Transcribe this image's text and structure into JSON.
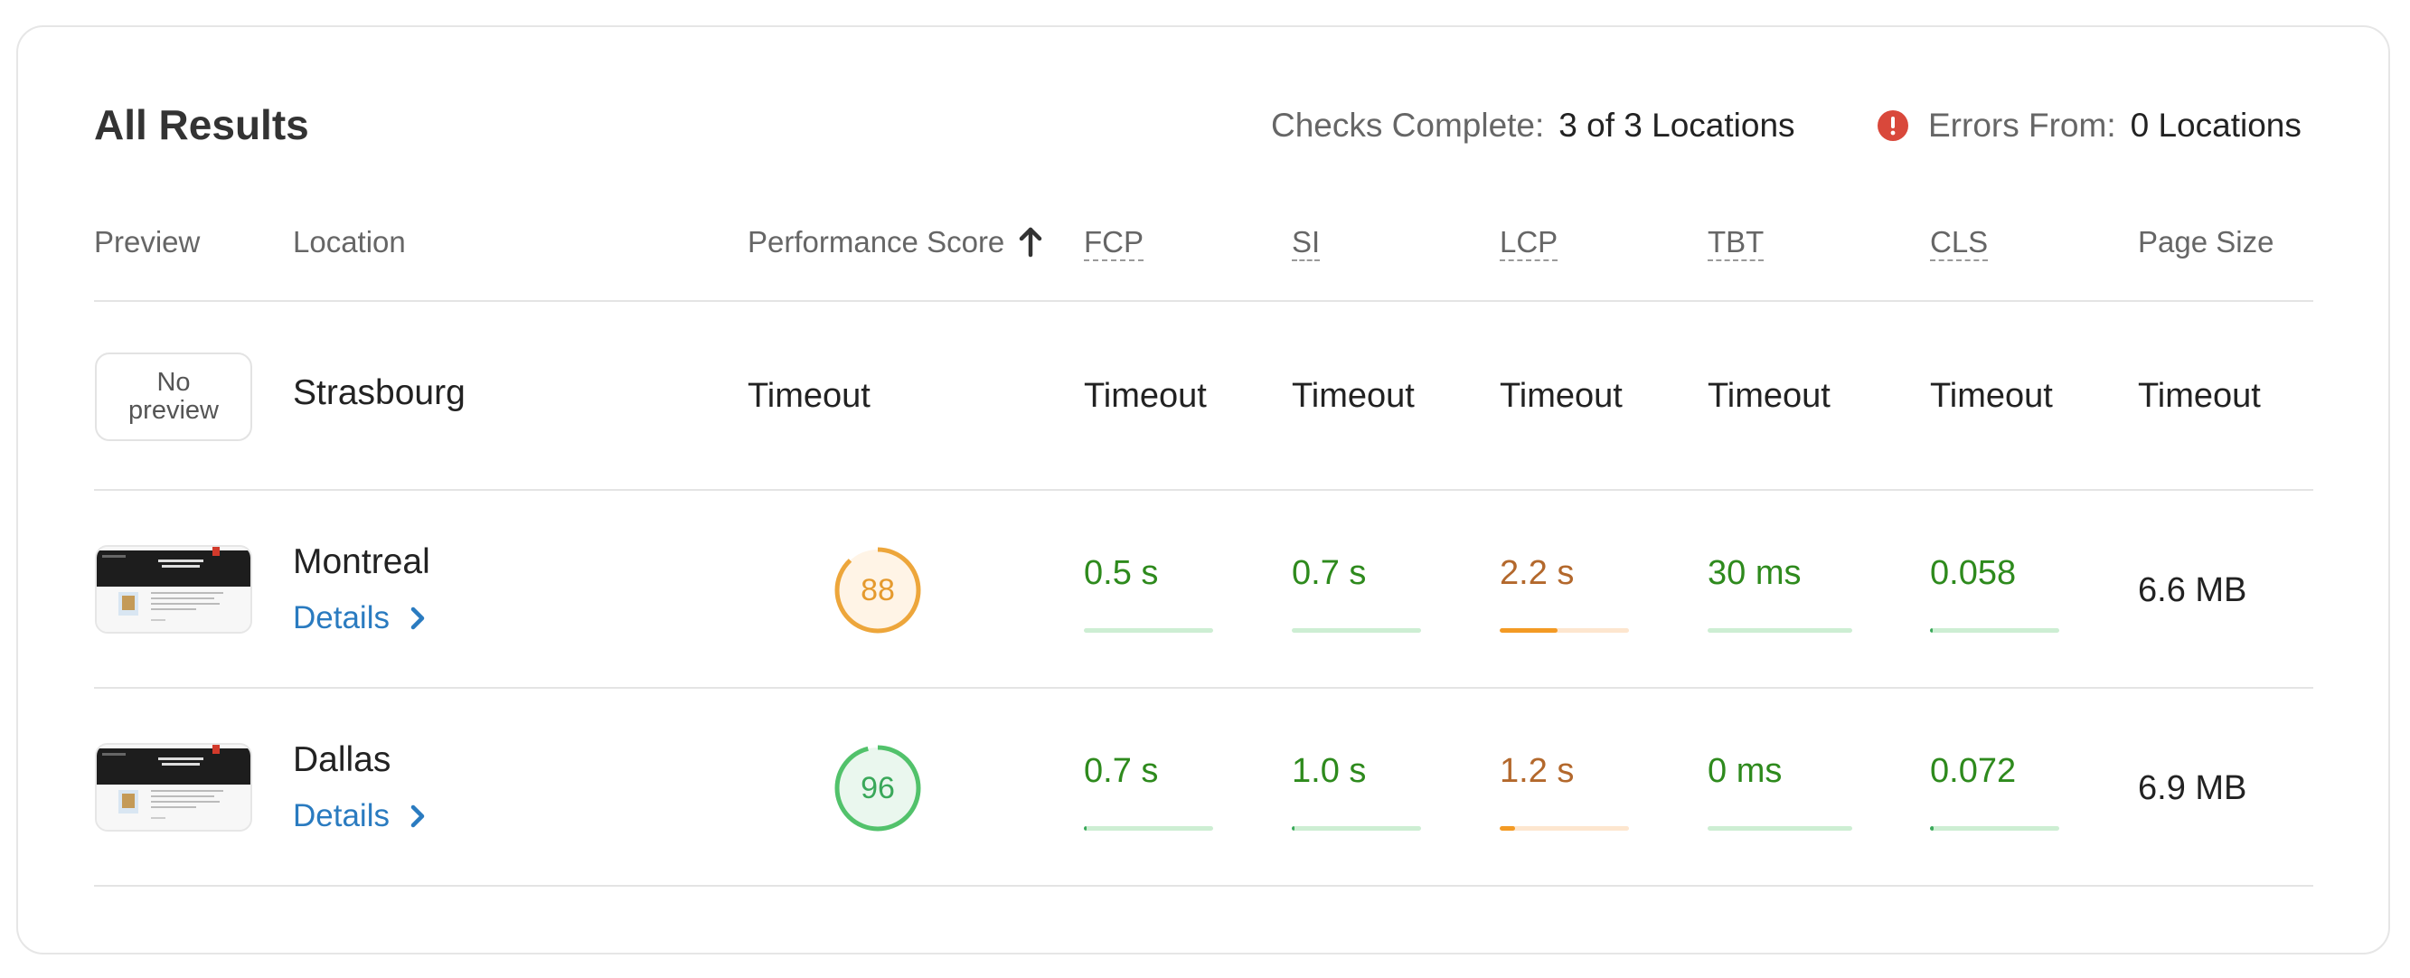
{
  "title": "All Results",
  "summary": {
    "checks_label": "Checks Complete:",
    "checks_value": "3 of 3 Locations",
    "errors_label": "Errors From:",
    "errors_value": "0 Locations"
  },
  "columns": {
    "preview": "Preview",
    "location": "Location",
    "performance": "Performance Score",
    "fcp": "FCP",
    "si": "SI",
    "lcp": "LCP",
    "tbt": "TBT",
    "cls": "CLS",
    "page_size": "Page Size"
  },
  "colors": {
    "good": "#2e8a1d",
    "average": "#b3682c",
    "score_avg_ring": "#eda63b",
    "score_avg_text": "#e59a2e",
    "score_good_ring": "#52c26b",
    "score_good_text": "#3aa85a",
    "link": "#2a7bc0",
    "error": "#d9483b"
  },
  "rows": [
    {
      "preview": "No\npreview",
      "location": "Strasbourg",
      "performance": "Timeout",
      "fcp": "Timeout",
      "si": "Timeout",
      "lcp": "Timeout",
      "tbt": "Timeout",
      "cls": "Timeout",
      "page_size": "Timeout"
    },
    {
      "location": "Montreal",
      "details": "Details",
      "score": "88",
      "score_fraction": 0.88,
      "fcp": "0.5 s",
      "si": "0.7 s",
      "lcp": "2.2 s",
      "tbt": "30 ms",
      "cls": "0.058",
      "page_size": "6.6 MB",
      "bars": {
        "fcp": 0.0,
        "si": 0.0,
        "lcp": 0.45,
        "tbt": 0.0,
        "cls": 0.02
      }
    },
    {
      "location": "Dallas",
      "details": "Details",
      "score": "96",
      "score_fraction": 0.96,
      "fcp": "0.7 s",
      "si": "1.0 s",
      "lcp": "1.2 s",
      "tbt": "0 ms",
      "cls": "0.072",
      "page_size": "6.9 MB",
      "bars": {
        "fcp": 0.02,
        "si": 0.02,
        "lcp": 0.12,
        "tbt": 0.0,
        "cls": 0.03
      }
    }
  ]
}
